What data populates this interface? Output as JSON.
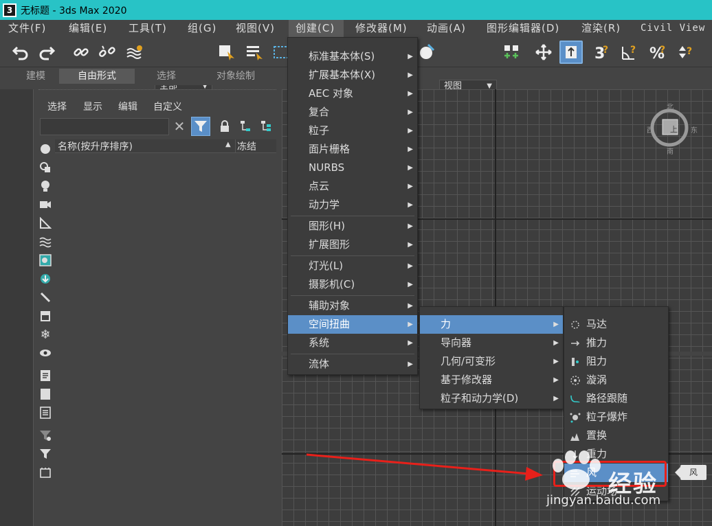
{
  "window": {
    "title": "无标题 - 3ds Max 2020",
    "app_icon": "3"
  },
  "menubar": {
    "items": [
      "文件(F)",
      "编辑(E)",
      "工具(T)",
      "组(G)",
      "视图(V)",
      "创建(C)",
      "修改器(M)",
      "动画(A)",
      "图形编辑器(D)",
      "渲染(R)",
      "Civil View"
    ]
  },
  "toolbar": {
    "selection_filter": "全部",
    "view_dropdown": "视图"
  },
  "ribbon_tabs": [
    "建模",
    "自由形式",
    "选择",
    "对象绘制"
  ],
  "scene_explorer": {
    "tabs": [
      "选择",
      "显示",
      "编辑",
      "自定义"
    ],
    "search_placeholder": "",
    "column_name": "名称(按升序排序)",
    "column_frozen": "冻结"
  },
  "viewcube": {
    "top": "北",
    "left": "西",
    "right": "东",
    "bottom": "南",
    "face": "上"
  },
  "create_menu": {
    "items": [
      "标准基本体(S)",
      "扩展基本体(X)",
      "AEC 对象",
      "复合",
      "粒子",
      "面片栅格",
      "NURBS",
      "点云",
      "动力学",
      "图形(H)",
      "扩展图形",
      "灯光(L)",
      "摄影机(C)",
      "辅助对象",
      "空间扭曲",
      "系统",
      "流体"
    ],
    "highlighted": "空间扭曲"
  },
  "spacewarp_menu": {
    "items": [
      "力",
      "导向器",
      "几何/可变形",
      "基于修改器",
      "粒子和动力学(D)"
    ],
    "highlighted": "力"
  },
  "force_menu": {
    "items": [
      "马达",
      "推力",
      "阻力",
      "漩涡",
      "路径跟随",
      "粒子爆炸",
      "置换",
      "重力",
      "风",
      "运动场"
    ],
    "highlighted": "风"
  },
  "tooltip": "风",
  "watermark": {
    "text": "经验",
    "url": "jingyan.baidu.com"
  },
  "colors": {
    "titlebar": "#28c3c6",
    "highlight": "#5b8fc7",
    "annotation": "#e8201a"
  }
}
